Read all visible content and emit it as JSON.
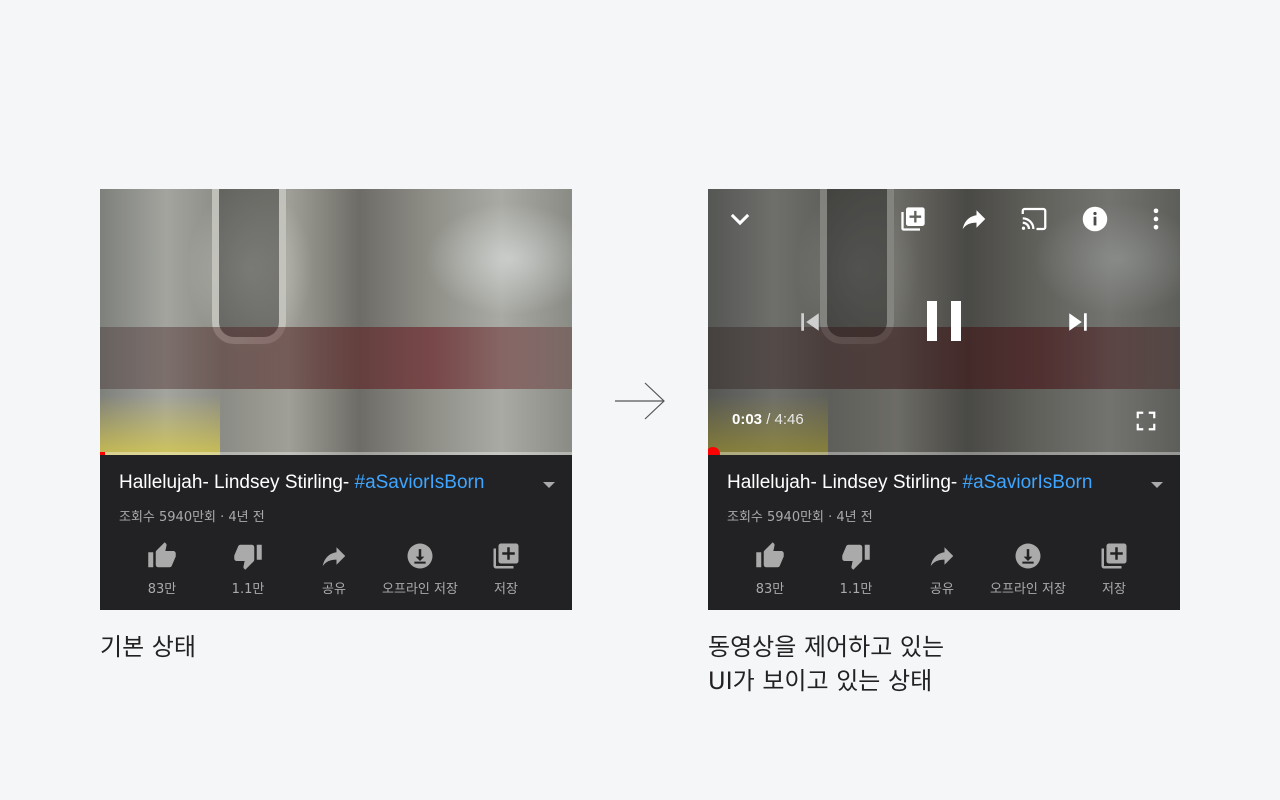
{
  "colors": {
    "page_bg": "#f5f6f8",
    "panel_bg": "#222124",
    "progress": "#ff0000",
    "hashtag": "#3ea6ff",
    "meta_text": "#aaaaaa"
  },
  "left_panel": {
    "video": {
      "progress_fraction": 0.011
    },
    "title_text": "Hallelujah- Lindsey Stirling- ",
    "title_hashtag": "#aSaviorIsBorn",
    "meta": "조회수 5940만회 · 4년 전",
    "actions": [
      {
        "icon": "thumbs-up-icon",
        "label": "83만"
      },
      {
        "icon": "thumbs-down-icon",
        "label": "1.1만"
      },
      {
        "icon": "share-icon",
        "label": "공유"
      },
      {
        "icon": "download-icon",
        "label": "오프라인 저장"
      },
      {
        "icon": "playlist-add-icon",
        "label": "저장"
      }
    ]
  },
  "right_panel": {
    "video": {
      "current_time": "0:03",
      "separator": "/",
      "duration": "4:46",
      "progress_fraction": 0.011,
      "top_controls": [
        "collapse-icon",
        "add-to-playlist-icon",
        "share-icon",
        "cast-icon",
        "info-icon",
        "more-icon"
      ],
      "center_controls": [
        "previous-icon",
        "pause-icon",
        "next-icon"
      ],
      "bottom_controls": [
        "fullscreen-icon"
      ]
    },
    "title_text": "Hallelujah- Lindsey Stirling- ",
    "title_hashtag": "#aSaviorIsBorn",
    "meta": "조회수 5940만회 · 4년 전",
    "actions": [
      {
        "icon": "thumbs-up-icon",
        "label": "83만"
      },
      {
        "icon": "thumbs-down-icon",
        "label": "1.1만"
      },
      {
        "icon": "share-icon",
        "label": "공유"
      },
      {
        "icon": "download-icon",
        "label": "오프라인 저장"
      },
      {
        "icon": "playlist-add-icon",
        "label": "저장"
      }
    ]
  },
  "arrow_icon": "arrow-right-icon",
  "captions": {
    "left": "기본 상태",
    "right_line1": "동영상을 제어하고 있는",
    "right_line2": "UI가 보이고 있는 상태"
  }
}
